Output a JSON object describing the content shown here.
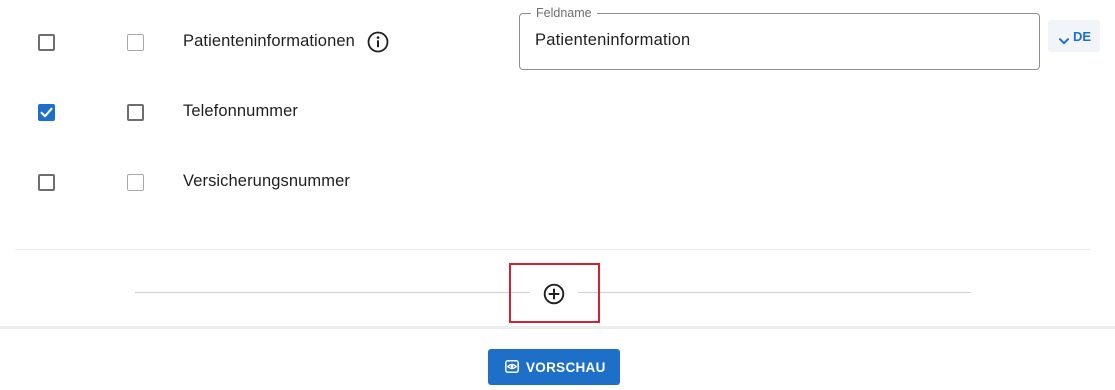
{
  "fields": [
    {
      "label": "Patienteninformationen",
      "checked": false,
      "has_info_icon": true,
      "field_name_label": "Feldname",
      "field_name_value": "Patienteninformation",
      "language": "DE"
    },
    {
      "label": "Telefonnummer",
      "checked": true
    },
    {
      "label": "Versicherungsnummer",
      "checked": false
    }
  ],
  "icons": {
    "info": "info-circle-icon",
    "check": "checkmark-icon",
    "add": "plus-circle-icon",
    "language_chevron": "chevron-down-icon",
    "preview": "eye-icon"
  },
  "footer": {
    "preview_label": "VORSCHAU"
  },
  "colors": {
    "accent": "#1e6fc8",
    "highlight_border": "#d7202e",
    "checkbox_border": "#6e6e6e",
    "divider": "#cfcfcf"
  }
}
